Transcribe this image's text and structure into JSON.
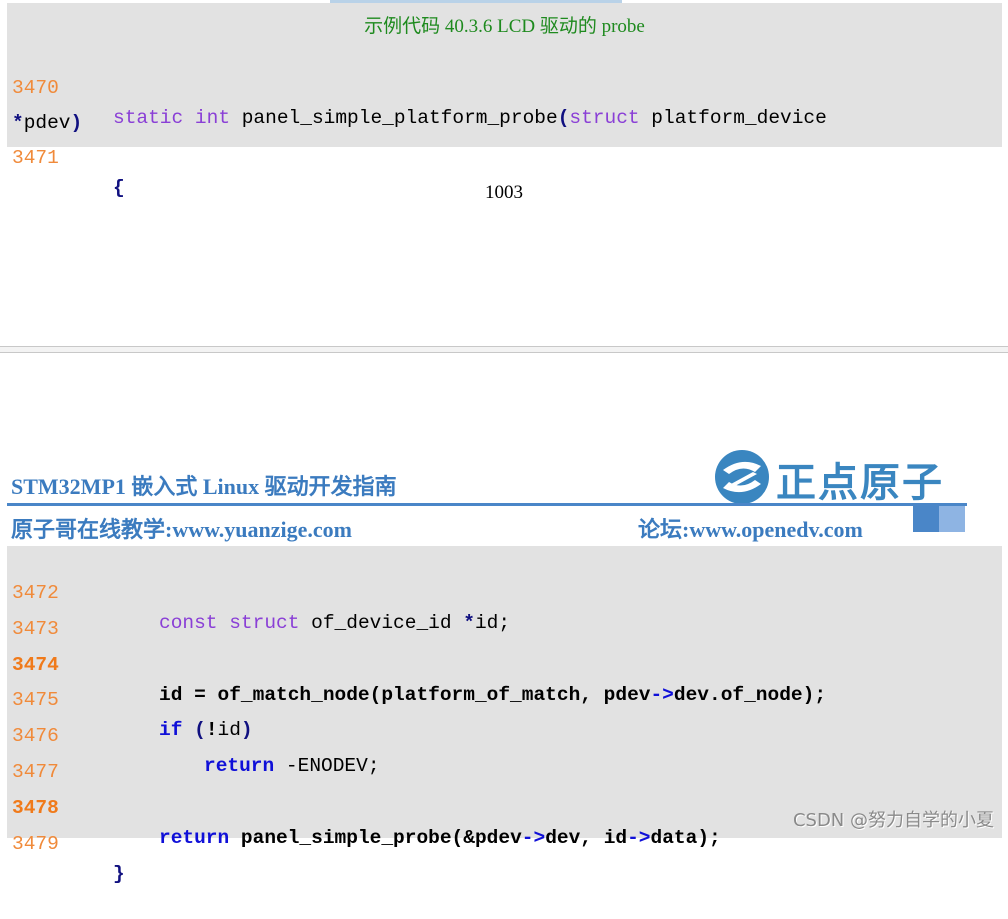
{
  "caption": "示例代码 40.3.6 LCD 驱动的 probe",
  "page_number": "1003",
  "header": {
    "title": "STM32MP1 嵌入式 Linux 驱动开发指南",
    "brand": "正点原子",
    "left_link": "原子哥在线教学:www.yuanzige.com",
    "right_link": "论坛:www.openedv.com"
  },
  "watermark": "CSDN @努力自学的小夏",
  "colors": {
    "line_number": "#f08a3a",
    "keyword": "#8a3fd6",
    "keyword_bold": "#1010d8",
    "caption": "#1e8a1e",
    "brand_blue": "#3b7bbf",
    "code_bg": "#e2e2e2"
  },
  "code_block_1": [
    {
      "ln": "3470",
      "parts": [
        "static",
        " ",
        "int",
        " panel_simple_platform_probe",
        "(",
        "struct",
        " platform_device"
      ]
    },
    {
      "ln": "",
      "parts": [
        "*",
        "pdev",
        ")"
      ]
    },
    {
      "ln": "3471",
      "parts": [
        "{"
      ]
    }
  ],
  "code_block_2": [
    {
      "ln": "3472",
      "text_kw1": "const",
      "text_kw2": "struct",
      "text_rest": " of_device_id ",
      "star": "*",
      "tail": "id;"
    },
    {
      "ln": "3473"
    },
    {
      "ln": "3474",
      "text": "id = of_match_node(platform_of_match, pdev",
      "arrow": "->",
      "tail": "dev.of_node);"
    },
    {
      "ln": "3475",
      "kw": "if",
      "open": " (",
      "bang": "!",
      "id": "id",
      "close": ")"
    },
    {
      "ln": "3476",
      "kw": "return",
      "tail": " -ENODEV;"
    },
    {
      "ln": "3477"
    },
    {
      "ln": "3478",
      "kw": "return",
      "text": " panel_simple_probe(&pdev",
      "arrow": "->",
      "mid": "dev, id",
      "arrow2": "->",
      "tail": "data);"
    },
    {
      "ln": "3479",
      "brace": "}"
    }
  ]
}
